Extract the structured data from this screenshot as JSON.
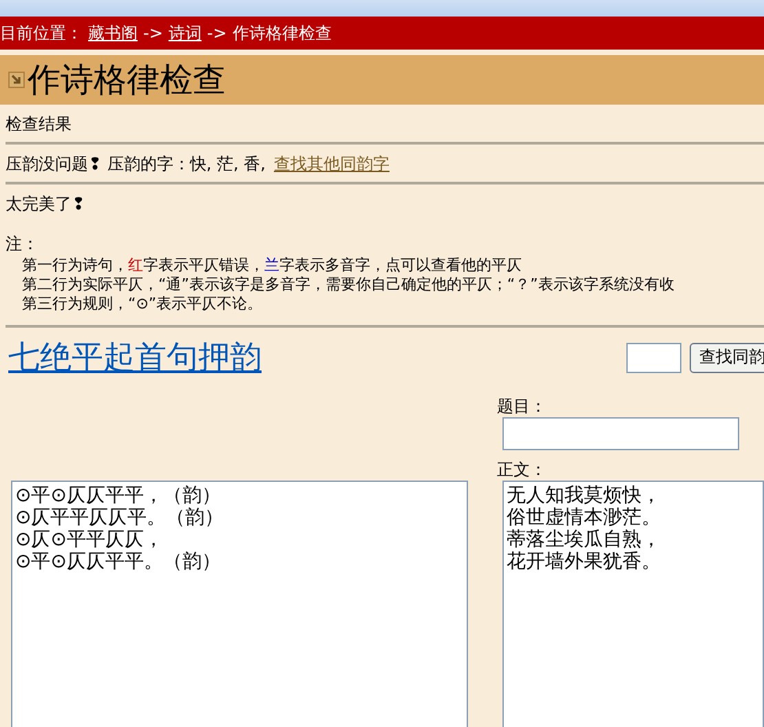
{
  "breadcrumb": {
    "label": "目前位置：",
    "links": [
      "藏书阁",
      "诗词"
    ],
    "current": "作诗格律检查",
    "separator": "->"
  },
  "page_title": "作诗格律检查",
  "section_title": "检查结果",
  "rhyme_result": {
    "text": "压韵没问题❢ 压韵的字：快, 茫, 香,",
    "link": "查找其他同韵字"
  },
  "verdict": "太完美了❢",
  "notes": {
    "label": "注：",
    "lines": [
      {
        "parts": [
          {
            "text": "第一行为诗句，",
            "color": "#000000"
          },
          {
            "text": "红",
            "color": "#cc0000"
          },
          {
            "text": "字表示平仄错误，",
            "color": "#000000"
          },
          {
            "text": "兰",
            "color": "#0000cc"
          },
          {
            "text": "字表示多音字，点可以查看他的平仄",
            "color": "#000000"
          }
        ]
      },
      {
        "parts": [
          {
            "text": "第二行为实际平仄，“通”表示该字是多音字，需要你自己确定他的平仄；“？”表示该字系统没有收",
            "color": "#000000"
          }
        ]
      },
      {
        "parts": [
          {
            "text": "第三行为规则，“⊙”表示平仄不论。",
            "color": "#000000"
          }
        ]
      }
    ]
  },
  "form_title": "七绝平起首句押韵",
  "search": {
    "button": "查找同韵"
  },
  "title_field": {
    "label": "题目："
  },
  "body_field": {
    "label": "正文：",
    "lines": [
      "无人知我莫烦快，",
      "俗世虚情本渺茫。",
      "蒂落尘埃瓜自熟，",
      "花开墙外果犹香。"
    ]
  },
  "pattern_lines": [
    "⊙平⊙仄仄平平，（韵）",
    "⊙仄平平仄仄平。（韵）",
    "⊙仄⊙平平仄仄，",
    "⊙平⊙仄仄平平。（韵）"
  ]
}
